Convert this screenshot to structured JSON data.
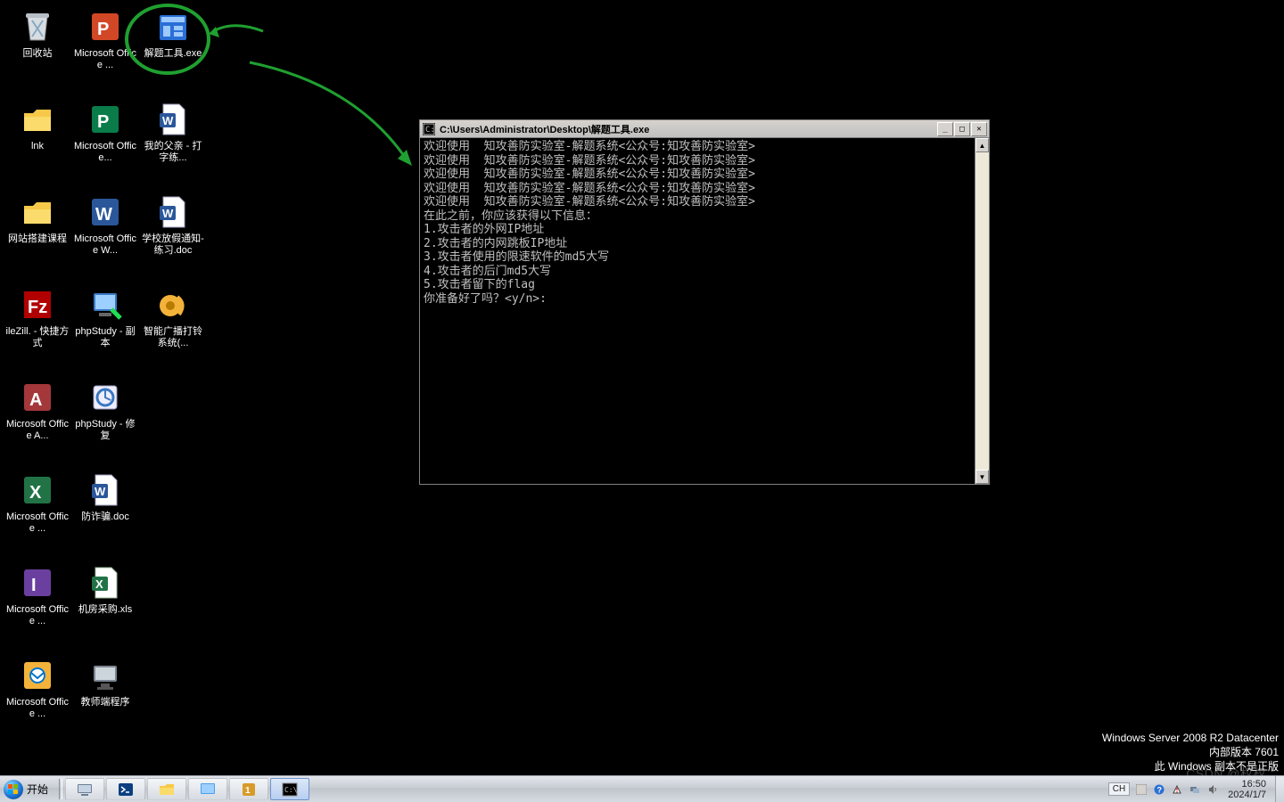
{
  "desktop": {
    "icons": [
      {
        "label": "回收站",
        "kind": "recycle"
      },
      {
        "label": "Microsoft Office ...",
        "kind": "ppt"
      },
      {
        "label": "解题工具.exe",
        "kind": "exe",
        "highlight": true
      },
      {
        "label": "lnk",
        "kind": "folder"
      },
      {
        "label": "Microsoft Office...",
        "kind": "pub"
      },
      {
        "label": "我的父亲 - 打字练...",
        "kind": "docx"
      },
      {
        "label": "网站搭建课程",
        "kind": "folder"
      },
      {
        "label": "Microsoft Office W...",
        "kind": "word"
      },
      {
        "label": "学校放假通知-练习.doc",
        "kind": "docx"
      },
      {
        "label": "ileZill. - 快捷方式",
        "kind": "filezilla"
      },
      {
        "label": "phpStudy - 副本",
        "kind": "phpstudy"
      },
      {
        "label": "智能广播打铃系统(...",
        "kind": "speaker"
      },
      {
        "label": "Microsoft Office A...",
        "kind": "access"
      },
      {
        "label": "phpStudy - 修复",
        "kind": "phpstudy2"
      },
      {
        "label": "",
        "kind": "empty"
      },
      {
        "label": "Microsoft Office ...",
        "kind": "excel"
      },
      {
        "label": "防诈骗.doc",
        "kind": "docx"
      },
      {
        "label": "",
        "kind": "empty"
      },
      {
        "label": "Microsoft Office ...",
        "kind": "infopath"
      },
      {
        "label": "机房采购.xls",
        "kind": "xls"
      },
      {
        "label": "",
        "kind": "empty"
      },
      {
        "label": "Microsoft Office ...",
        "kind": "outlook"
      },
      {
        "label": "教师端程序",
        "kind": "teacher"
      },
      {
        "label": "",
        "kind": "empty"
      }
    ]
  },
  "console": {
    "title": "C:\\Users\\Administrator\\Desktop\\解题工具.exe",
    "lines": [
      "欢迎使用  知攻善防实验室-解题系统<公众号:知攻善防实验室>",
      "欢迎使用  知攻善防实验室-解题系统<公众号:知攻善防实验室>",
      "欢迎使用  知攻善防实验室-解题系统<公众号:知攻善防实验室>",
      "欢迎使用  知攻善防实验室-解题系统<公众号:知攻善防实验室>",
      "欢迎使用  知攻善防实验室-解题系统<公众号:知攻善防实验室>",
      "在此之前，你应该获得以下信息：",
      "1.攻击者的外网IP地址",
      "2.攻击者的内网跳板IP地址",
      "3.攻击者使用的限速软件的md5大写",
      "4.攻击者的后门md5大写",
      "5.攻击者留下的flag",
      "你准备好了吗？<y/n>:"
    ],
    "min": "_",
    "max": "□",
    "close": "✕",
    "up": "▲",
    "down": "▼"
  },
  "watermark": {
    "line1": "Windows Server 2008 R2 Datacenter",
    "line2": "内部版本 7601",
    "line3": "此 Windows 副本不是正版"
  },
  "csdn": "CSDN @权权",
  "taskbar": {
    "start": "开始",
    "lang": "CH",
    "time": "16:50",
    "date": "2024/1/7"
  }
}
